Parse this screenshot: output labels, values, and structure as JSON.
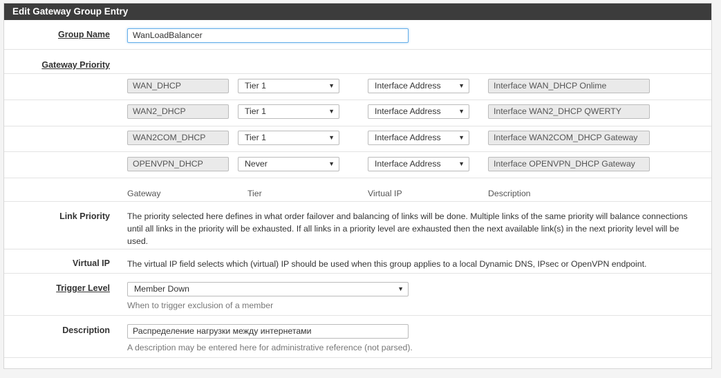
{
  "panel": {
    "title": "Edit Gateway Group Entry"
  },
  "group_name": {
    "label": "Group Name",
    "value": "WanLoadBalancer"
  },
  "gateway_priority": {
    "label": "Gateway Priority",
    "rows": [
      {
        "gateway": "WAN_DHCP",
        "tier": "Tier 1",
        "virtual_ip": "Interface Address",
        "description": "Interface WAN_DHCP Onlime"
      },
      {
        "gateway": "WAN2_DHCP",
        "tier": "Tier 1",
        "virtual_ip": "Interface Address",
        "description": "Interface WAN2_DHCP QWERTY"
      },
      {
        "gateway": "WAN2COM_DHCP",
        "tier": "Tier 1",
        "virtual_ip": "Interface Address",
        "description": "Interface WAN2COM_DHCP Gateway"
      },
      {
        "gateway": "OPENVPN_DHCP",
        "tier": "Never",
        "virtual_ip": "Interface Address",
        "description": "Interface OPENVPN_DHCP Gateway"
      }
    ],
    "columns": {
      "gateway": "Gateway",
      "tier": "Tier",
      "virtual_ip": "Virtual IP",
      "description": "Description"
    }
  },
  "link_priority": {
    "label": "Link Priority",
    "text_1": "The priority selected here defines in what order failover and balancing of links will be done. Multiple links of the same priority will balance connections",
    "text_2": "until all links in the priority will be exhausted. If all links in a priority level are exhausted then the next available link(s) in the next priority level will be",
    "text_3": "used."
  },
  "virtual_ip": {
    "label": "Virtual IP",
    "text": "The virtual IP field selects which (virtual) IP should be used when this group applies to a local Dynamic DNS, IPsec or OpenVPN endpoint."
  },
  "trigger_level": {
    "label": "Trigger Level",
    "value": "Member Down",
    "help": "When to trigger exclusion of a member"
  },
  "description": {
    "label": "Description",
    "value": "Распределение нагрузки между интернетами",
    "help": "A description may be entered here for administrative reference (not parsed)."
  },
  "icons": {
    "dropdown": "▼"
  }
}
